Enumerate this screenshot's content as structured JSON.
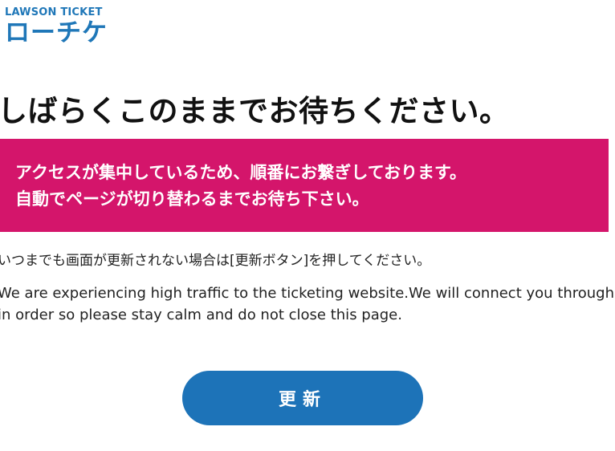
{
  "brand": {
    "name_en": "LAWSON TICKET",
    "name_ja": "ローチケ"
  },
  "heading": "しばらくこのままでお待ちください。",
  "notice": {
    "line1": "アクセスが集中しているため、順番にお繋ぎしております。",
    "line2": "自動でページが切り替わるまでお待ち下さい。",
    "background": "#d4156b"
  },
  "info_ja": "いつまでも画面が更新されない場合は[更新ボタン]を押してください。",
  "info_en": {
    "line1": "We are experiencing high traffic to the ticketing website.We will connect you through",
    "line2": "in order so please stay calm and do not close this page."
  },
  "refresh_button": {
    "label": "更新",
    "color": "#1d73b8"
  }
}
